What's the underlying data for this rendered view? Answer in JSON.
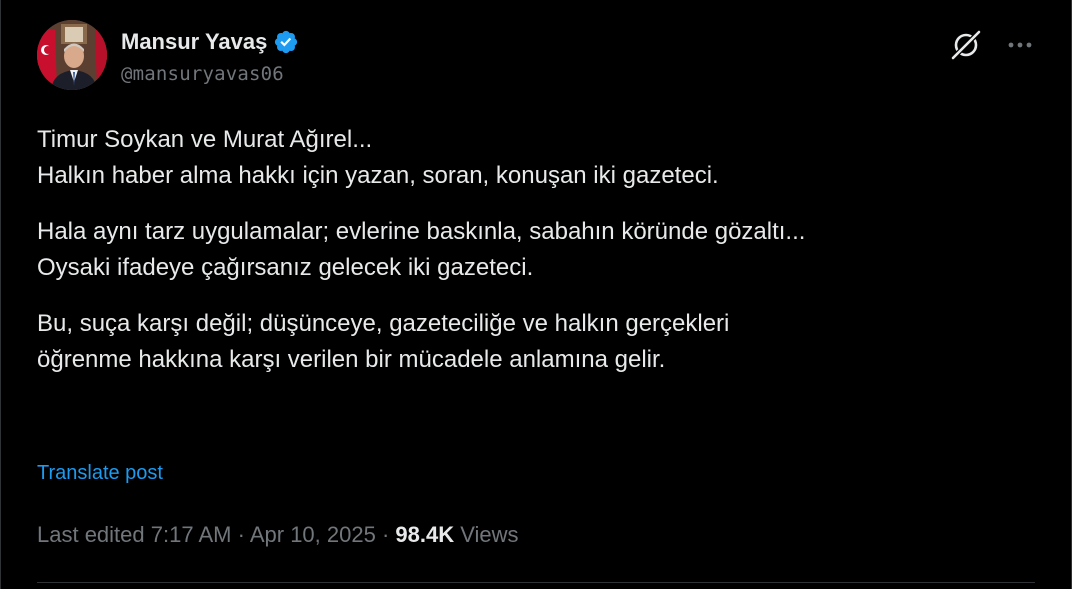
{
  "author": {
    "display_name": "Mansur Yavaş",
    "handle": "@mansuryavas06",
    "avatar_icon": "profile-photo",
    "verified_icon": "verified-badge-icon",
    "verified_color": "#1d9bf0"
  },
  "actions": {
    "grok_icon": "grok-icon",
    "more_icon": "more-options-icon"
  },
  "post": {
    "paragraphs": [
      [
        "Timur Soykan ve Murat Ağırel...",
        "Halkın haber alma hakkı için yazan, soran, konuşan iki gazeteci."
      ],
      [
        "Hala aynı tarz uygulamalar; evlerine baskınla, sabahın köründe gözaltı...",
        "Oysaki ifadeye çağırsanız gelecek iki gazeteci."
      ],
      [
        "Bu, suça karşı değil; düşünceye, gazeteciliğe ve halkın gerçekleri",
        "öğrenme hakkına karşı verilen bir mücadele anlamına gelir."
      ]
    ],
    "translate_label": "Translate post"
  },
  "meta": {
    "edited_label": "Last edited",
    "time": "7:17 AM",
    "separator": "·",
    "date": "Apr 10, 2025",
    "views_count": "98.4K",
    "views_label": "Views"
  },
  "colors": {
    "background": "#000000",
    "text": "#e7e9ea",
    "secondary_text": "#71767b",
    "link": "#1d9bf0",
    "divider": "#2f3336"
  }
}
